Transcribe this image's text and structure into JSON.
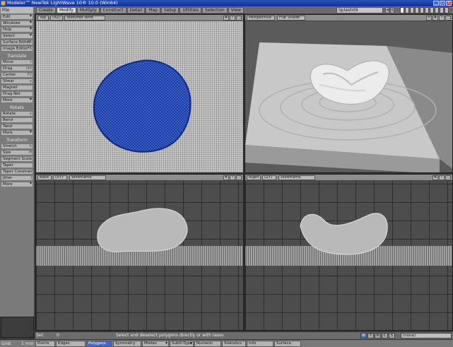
{
  "window": {
    "title": "Modeler™ NewTek LightWave 10® 10.0 (Win64)"
  },
  "menu": {
    "file_label": "File",
    "tabs": [
      {
        "label": "Create",
        "active": false
      },
      {
        "label": "Modify",
        "active": true
      },
      {
        "label": "Multiply",
        "active": false
      },
      {
        "label": "Construct",
        "active": false
      },
      {
        "label": "Detail",
        "active": false
      },
      {
        "label": "Map",
        "active": false
      },
      {
        "label": "Setup",
        "active": false
      },
      {
        "label": "Utilities",
        "active": false
      },
      {
        "label": "Selection",
        "active": false
      },
      {
        "label": "View",
        "active": false
      }
    ],
    "layer_name": "Splash09",
    "layer_number": "1"
  },
  "toolbar": {
    "top_items": [
      {
        "label": "Edit",
        "dd": true,
        "sc": ""
      },
      {
        "label": "Windows",
        "dd": true,
        "sc": ""
      },
      {
        "label": "Help",
        "dd": true,
        "sc": ""
      },
      {
        "label": "Select",
        "dd": true,
        "sc": ""
      },
      {
        "label": "Surface Editor",
        "dd": false,
        "sc": "F5"
      },
      {
        "label": "Image Editor",
        "dd": false,
        "sc": "F6"
      }
    ],
    "groups": [
      {
        "heading": "Translate",
        "items": [
          {
            "label": "Move",
            "dd": false,
            "sc": "t"
          },
          {
            "label": "Drag",
            "dd": false,
            "sc": "ctrl"
          },
          {
            "label": "Center",
            "dd": false,
            "sc": "F2"
          },
          {
            "label": "Shear",
            "dd": false,
            "sc": "y"
          },
          {
            "label": "Magnet",
            "dd": false,
            "sc": ""
          },
          {
            "label": "Drag Net",
            "dd": false,
            "sc": ""
          },
          {
            "label": "More",
            "dd": true,
            "sc": ""
          }
        ]
      },
      {
        "heading": "Rotate",
        "items": [
          {
            "label": "Rotate",
            "dd": false,
            "sc": "y"
          },
          {
            "label": "Bend",
            "dd": false,
            "sc": ""
          },
          {
            "label": "Twist",
            "dd": false,
            "sc": ""
          },
          {
            "label": "More",
            "dd": true,
            "sc": ""
          }
        ]
      },
      {
        "heading": "Transform",
        "items": [
          {
            "label": "Stretch",
            "dd": false,
            "sc": "h"
          },
          {
            "label": "Size",
            "dd": false,
            "sc": "H"
          },
          {
            "label": "Segment Scale",
            "dd": false,
            "sc": ""
          },
          {
            "label": "Taper",
            "dd": false,
            "sc": ""
          },
          {
            "label": "Taper Constrain",
            "dd": false,
            "sc": ""
          },
          {
            "label": "Jitter",
            "dd": false,
            "sc": "J"
          },
          {
            "label": "More",
            "dd": true,
            "sc": ""
          }
        ]
      }
    ]
  },
  "viewports": {
    "top": {
      "view": "Top",
      "axes": "(XZ)",
      "shade": "Textured Wire"
    },
    "perspective": {
      "view": "Perspective",
      "shade": "Flat Shade"
    },
    "back": {
      "view": "Back",
      "axes": "(XY)",
      "shade": "Wireframe"
    },
    "right": {
      "view": "Right",
      "axes": "(ZY)",
      "shade": "Wireframe"
    }
  },
  "infobar": {
    "sel_label": "Sel:",
    "sel_count": "0",
    "message": "Select and deselect polygons directly or with lasso.",
    "wtmcs": [
      {
        "label": "W",
        "on": true
      },
      {
        "label": "T",
        "on": false
      },
      {
        "label": "M",
        "on": false
      },
      {
        "label": "C",
        "on": false
      },
      {
        "label": "S",
        "on": false
      }
    ],
    "surface": "(none)"
  },
  "modebar": {
    "grid_label": "Grid:",
    "grid_value": "1 mm",
    "points": "Points",
    "edges": "Edges",
    "polygons": "Polygons",
    "symmetry": "Symmetry",
    "modes": "Modes",
    "subd": "SubD-Type",
    "numeric": "Numeric",
    "statistics": "Statistics",
    "info": "Info",
    "surface": "Surface"
  },
  "colors": {
    "accent": "#3b6bd4",
    "wire_blue": "#1c3fa8"
  }
}
